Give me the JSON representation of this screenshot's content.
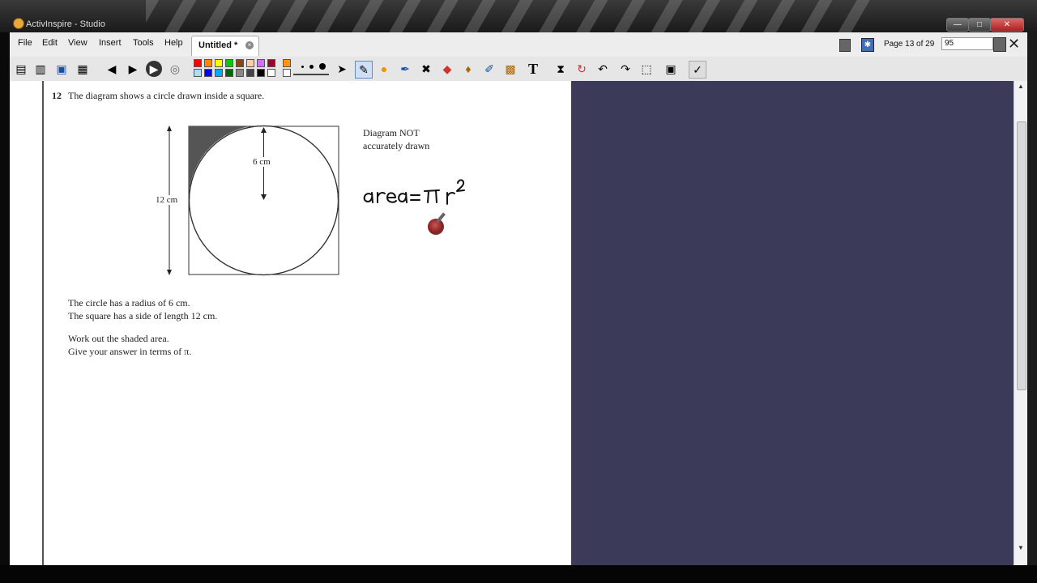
{
  "window": {
    "title": "ActivInspire - Studio",
    "min": "—",
    "max": "□",
    "close": "✕"
  },
  "menu": [
    "File",
    "Edit",
    "View",
    "Insert",
    "Tools",
    "Help"
  ],
  "tab": {
    "label": "Untitled *"
  },
  "page_nav": {
    "indicator": "Page 13 of 29",
    "zoom": "95"
  },
  "palette": [
    "#ff0000",
    "#ff8800",
    "#ffff00",
    "#00cc00",
    "#8b4513",
    "#ffccaa",
    "#d070ff",
    "#990033",
    "#aaddff",
    "#0000ff",
    "#00aaff",
    "#006600",
    "#888888",
    "#444444",
    "#000000",
    "#ffffff"
  ],
  "question": {
    "number": "12",
    "text": "The diagram shows a circle drawn inside a square.",
    "note_line1": "Diagram NOT",
    "note_line2": "accurately drawn",
    "radius_label": "6 cm",
    "side_label": "12 cm",
    "line1": "The circle has a radius of 6 cm.",
    "line2": "The square has a side of length 12 cm.",
    "line3": "Work out the shaded area.",
    "line4": "Give your answer in terms of π."
  },
  "colors": {
    "panel": "#3b3a58",
    "shade": "#555555",
    "ink": "#111111"
  },
  "icons": [
    "pointer-icon",
    "pen-icon",
    "highlighter-icon",
    "eraser-icon",
    "text-icon",
    "timer-icon",
    "undo-icon",
    "redo-icon"
  ]
}
